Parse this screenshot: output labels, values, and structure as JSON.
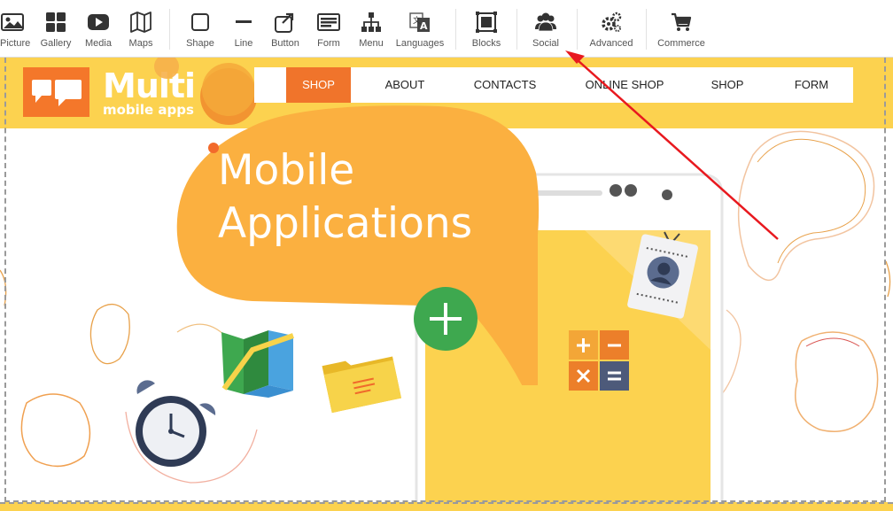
{
  "toolbar": {
    "items": [
      {
        "name": "picture",
        "label": "Picture",
        "icon": "picture-icon"
      },
      {
        "name": "gallery",
        "label": "Gallery",
        "icon": "gallery-icon"
      },
      {
        "name": "media",
        "label": "Media",
        "icon": "media-icon"
      },
      {
        "name": "maps",
        "label": "Maps",
        "icon": "maps-icon"
      },
      {
        "name": "shape",
        "label": "Shape",
        "icon": "shape-icon"
      },
      {
        "name": "line",
        "label": "Line",
        "icon": "line-icon"
      },
      {
        "name": "button",
        "label": "Button",
        "icon": "button-icon"
      },
      {
        "name": "form",
        "label": "Form",
        "icon": "form-icon"
      },
      {
        "name": "menu",
        "label": "Menu",
        "icon": "menu-icon"
      },
      {
        "name": "languages",
        "label": "Languages",
        "icon": "languages-icon"
      },
      {
        "name": "blocks",
        "label": "Blocks",
        "icon": "blocks-icon"
      },
      {
        "name": "social",
        "label": "Social",
        "icon": "social-icon"
      },
      {
        "name": "advanced",
        "label": "Advanced",
        "icon": "advanced-icon"
      },
      {
        "name": "commerce",
        "label": "Commerce",
        "icon": "commerce-icon"
      }
    ]
  },
  "site": {
    "logo_title": "Multi",
    "logo_subtitle": "mobile apps",
    "nav": [
      "SHOP",
      "ABOUT",
      "CONTACTS",
      "ONLINE SHOP",
      "SHOP",
      "FORM"
    ],
    "active_nav": "SHOP",
    "hero_line1": "Mobile",
    "hero_line2": "Applications"
  },
  "colors": {
    "yellow": "#fcd24f",
    "orange": "#f4772a",
    "bubble": "#fbb040",
    "green": "#3ea84f",
    "annotation_red": "#e8191f"
  }
}
